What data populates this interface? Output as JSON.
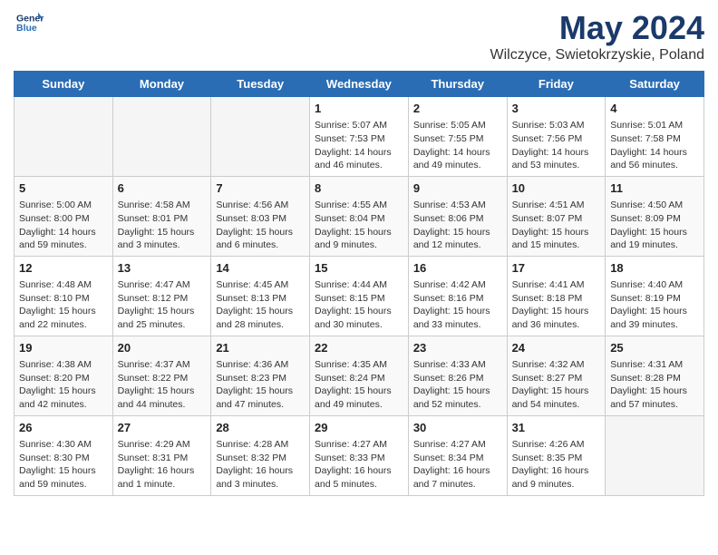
{
  "header": {
    "logo_line1": "General",
    "logo_line2": "Blue",
    "month": "May 2024",
    "location": "Wilczyce, Swietokrzyskie, Poland"
  },
  "weekdays": [
    "Sunday",
    "Monday",
    "Tuesday",
    "Wednesday",
    "Thursday",
    "Friday",
    "Saturday"
  ],
  "weeks": [
    [
      {
        "day": "",
        "content": ""
      },
      {
        "day": "",
        "content": ""
      },
      {
        "day": "",
        "content": ""
      },
      {
        "day": "1",
        "content": "Sunrise: 5:07 AM\nSunset: 7:53 PM\nDaylight: 14 hours\nand 46 minutes."
      },
      {
        "day": "2",
        "content": "Sunrise: 5:05 AM\nSunset: 7:55 PM\nDaylight: 14 hours\nand 49 minutes."
      },
      {
        "day": "3",
        "content": "Sunrise: 5:03 AM\nSunset: 7:56 PM\nDaylight: 14 hours\nand 53 minutes."
      },
      {
        "day": "4",
        "content": "Sunrise: 5:01 AM\nSunset: 7:58 PM\nDaylight: 14 hours\nand 56 minutes."
      }
    ],
    [
      {
        "day": "5",
        "content": "Sunrise: 5:00 AM\nSunset: 8:00 PM\nDaylight: 14 hours\nand 59 minutes."
      },
      {
        "day": "6",
        "content": "Sunrise: 4:58 AM\nSunset: 8:01 PM\nDaylight: 15 hours\nand 3 minutes."
      },
      {
        "day": "7",
        "content": "Sunrise: 4:56 AM\nSunset: 8:03 PM\nDaylight: 15 hours\nand 6 minutes."
      },
      {
        "day": "8",
        "content": "Sunrise: 4:55 AM\nSunset: 8:04 PM\nDaylight: 15 hours\nand 9 minutes."
      },
      {
        "day": "9",
        "content": "Sunrise: 4:53 AM\nSunset: 8:06 PM\nDaylight: 15 hours\nand 12 minutes."
      },
      {
        "day": "10",
        "content": "Sunrise: 4:51 AM\nSunset: 8:07 PM\nDaylight: 15 hours\nand 15 minutes."
      },
      {
        "day": "11",
        "content": "Sunrise: 4:50 AM\nSunset: 8:09 PM\nDaylight: 15 hours\nand 19 minutes."
      }
    ],
    [
      {
        "day": "12",
        "content": "Sunrise: 4:48 AM\nSunset: 8:10 PM\nDaylight: 15 hours\nand 22 minutes."
      },
      {
        "day": "13",
        "content": "Sunrise: 4:47 AM\nSunset: 8:12 PM\nDaylight: 15 hours\nand 25 minutes."
      },
      {
        "day": "14",
        "content": "Sunrise: 4:45 AM\nSunset: 8:13 PM\nDaylight: 15 hours\nand 28 minutes."
      },
      {
        "day": "15",
        "content": "Sunrise: 4:44 AM\nSunset: 8:15 PM\nDaylight: 15 hours\nand 30 minutes."
      },
      {
        "day": "16",
        "content": "Sunrise: 4:42 AM\nSunset: 8:16 PM\nDaylight: 15 hours\nand 33 minutes."
      },
      {
        "day": "17",
        "content": "Sunrise: 4:41 AM\nSunset: 8:18 PM\nDaylight: 15 hours\nand 36 minutes."
      },
      {
        "day": "18",
        "content": "Sunrise: 4:40 AM\nSunset: 8:19 PM\nDaylight: 15 hours\nand 39 minutes."
      }
    ],
    [
      {
        "day": "19",
        "content": "Sunrise: 4:38 AM\nSunset: 8:20 PM\nDaylight: 15 hours\nand 42 minutes."
      },
      {
        "day": "20",
        "content": "Sunrise: 4:37 AM\nSunset: 8:22 PM\nDaylight: 15 hours\nand 44 minutes."
      },
      {
        "day": "21",
        "content": "Sunrise: 4:36 AM\nSunset: 8:23 PM\nDaylight: 15 hours\nand 47 minutes."
      },
      {
        "day": "22",
        "content": "Sunrise: 4:35 AM\nSunset: 8:24 PM\nDaylight: 15 hours\nand 49 minutes."
      },
      {
        "day": "23",
        "content": "Sunrise: 4:33 AM\nSunset: 8:26 PM\nDaylight: 15 hours\nand 52 minutes."
      },
      {
        "day": "24",
        "content": "Sunrise: 4:32 AM\nSunset: 8:27 PM\nDaylight: 15 hours\nand 54 minutes."
      },
      {
        "day": "25",
        "content": "Sunrise: 4:31 AM\nSunset: 8:28 PM\nDaylight: 15 hours\nand 57 minutes."
      }
    ],
    [
      {
        "day": "26",
        "content": "Sunrise: 4:30 AM\nSunset: 8:30 PM\nDaylight: 15 hours\nand 59 minutes."
      },
      {
        "day": "27",
        "content": "Sunrise: 4:29 AM\nSunset: 8:31 PM\nDaylight: 16 hours\nand 1 minute."
      },
      {
        "day": "28",
        "content": "Sunrise: 4:28 AM\nSunset: 8:32 PM\nDaylight: 16 hours\nand 3 minutes."
      },
      {
        "day": "29",
        "content": "Sunrise: 4:27 AM\nSunset: 8:33 PM\nDaylight: 16 hours\nand 5 minutes."
      },
      {
        "day": "30",
        "content": "Sunrise: 4:27 AM\nSunset: 8:34 PM\nDaylight: 16 hours\nand 7 minutes."
      },
      {
        "day": "31",
        "content": "Sunrise: 4:26 AM\nSunset: 8:35 PM\nDaylight: 16 hours\nand 9 minutes."
      },
      {
        "day": "",
        "content": ""
      }
    ]
  ]
}
